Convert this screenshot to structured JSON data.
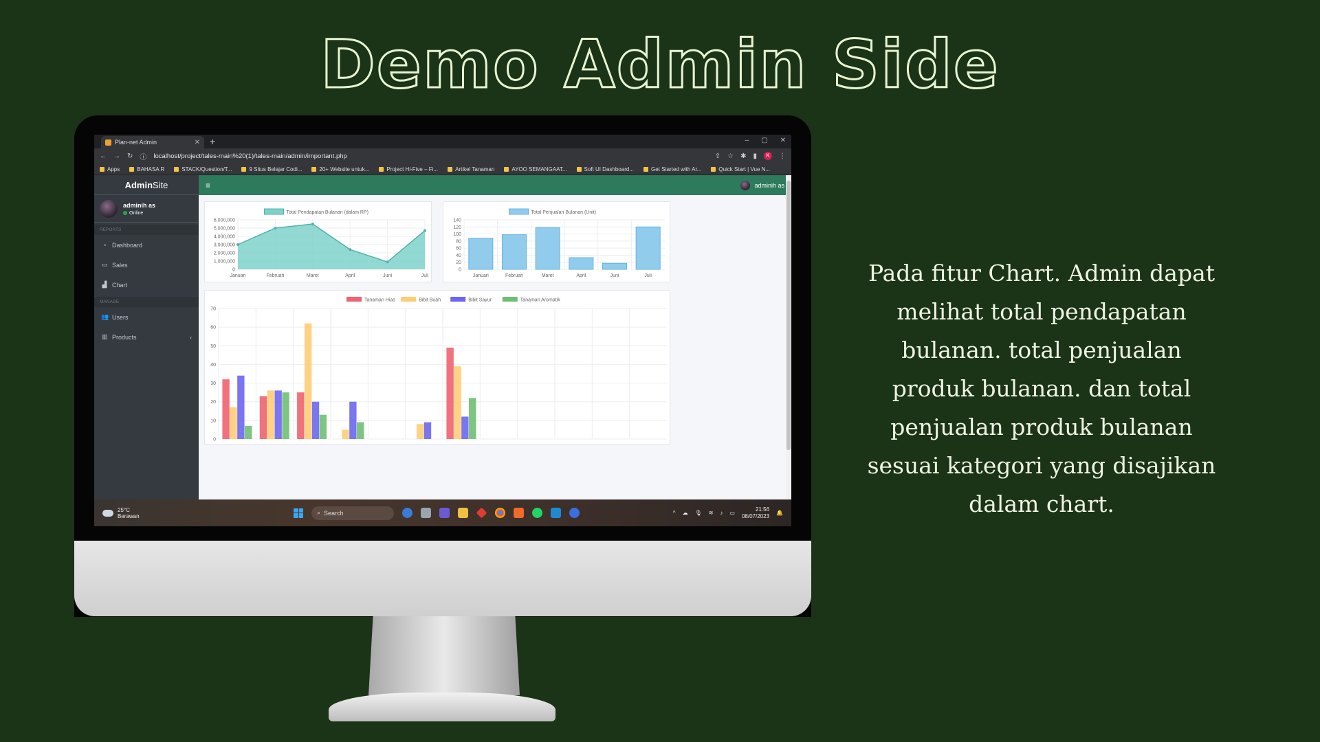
{
  "headline": "Demo Admin Side",
  "caption": "Pada fitur Chart. Admin dapat melihat total pendapatan bulanan. total penjualan produk bulanan. dan total penjualan produk bulanan sesuai kategori yang disajikan dalam chart.",
  "browser": {
    "tab_title": "Plan-net Admin",
    "url": "localhost/project/tales-main%20(1)/tales-main/admin/important.php",
    "bookmarks": [
      "Apps",
      "BAHASA R",
      "STACK/Question/T...",
      "9 Situs Belajar Codi...",
      "20+ Website untuk...",
      "Project Hi-Five – Fi...",
      "Artikel Tanaman",
      "AYOO SEMANGAAT...",
      "Soft UI Dashboard...",
      "Get Started with Ar...",
      "Quick Start | Vue N..."
    ],
    "profile_initial": "K"
  },
  "app": {
    "brand_bold": "Admin",
    "brand_rest": "Site",
    "user_name": "adminih as",
    "user_status": "Online",
    "top_user": "adminih as",
    "sections": {
      "reports": "REPORTS",
      "manage": "MANAGE"
    },
    "nav": {
      "dashboard": "Dashboard",
      "sales": "Sales",
      "chart": "Chart",
      "users": "Users",
      "products": "Products"
    }
  },
  "taskbar": {
    "temp": "25°C",
    "weather": "Berawan",
    "search": "Search",
    "time": "21:56",
    "date": "08/07/2023"
  },
  "chart_data": [
    {
      "type": "area",
      "title": "Total Pendapatan Bulanan (dalam RP)",
      "categories": [
        "Januari",
        "Februari",
        "Maret",
        "April",
        "Juni",
        "Juli"
      ],
      "series": [
        {
          "name": "Total Pendapatan Bulanan (dalam RP)",
          "values": [
            3000000,
            5000000,
            5500000,
            2400000,
            900000,
            4700000
          ]
        }
      ],
      "ylim": [
        0,
        6000000
      ],
      "yticks": [
        "6,000,000",
        "5,000,000",
        "4,000,000",
        "3,000,000",
        "2,000,000",
        "1,000,000",
        "0"
      ],
      "color": "#7fd1cb",
      "line_color": "#4fb3ab"
    },
    {
      "type": "bar",
      "title": "Total Penjualan Bulanan (Unit)",
      "categories": [
        "Januari",
        "Februari",
        "Maret",
        "April",
        "Juni",
        "Juli"
      ],
      "series": [
        {
          "name": "Total Penjualan Bulanan (Unit)",
          "values": [
            88,
            98,
            118,
            33,
            17,
            120
          ]
        }
      ],
      "ylim": [
        0,
        140
      ],
      "yticks": [
        "140",
        "120",
        "100",
        "80",
        "60",
        "40",
        "20",
        "0"
      ],
      "color": "#92ccec",
      "line_color": "#63b3e3"
    },
    {
      "type": "bar",
      "ylim": [
        0,
        70
      ],
      "yticks": [
        "70",
        "60",
        "50",
        "40",
        "30",
        "20",
        "10",
        "0"
      ],
      "groups": 12,
      "series": [
        {
          "name": "Tanaman Hias",
          "color": "#f0626f",
          "values": [
            32,
            23,
            25,
            0,
            0,
            0,
            49,
            0,
            0,
            0,
            0,
            0
          ]
        },
        {
          "name": "Bibit Buah",
          "color": "#ffcc74",
          "values": [
            17,
            26,
            62,
            5,
            0,
            8,
            39,
            0,
            0,
            0,
            0,
            0
          ]
        },
        {
          "name": "Bibit Sayur",
          "color": "#6c66f0",
          "values": [
            34,
            26,
            20,
            20,
            0,
            9,
            12,
            0,
            0,
            0,
            0,
            0
          ]
        },
        {
          "name": "Tanaman Aromatik",
          "color": "#6fbf73",
          "values": [
            7,
            25,
            13,
            9,
            0,
            0,
            22,
            0,
            0,
            0,
            0,
            0
          ]
        }
      ]
    }
  ]
}
